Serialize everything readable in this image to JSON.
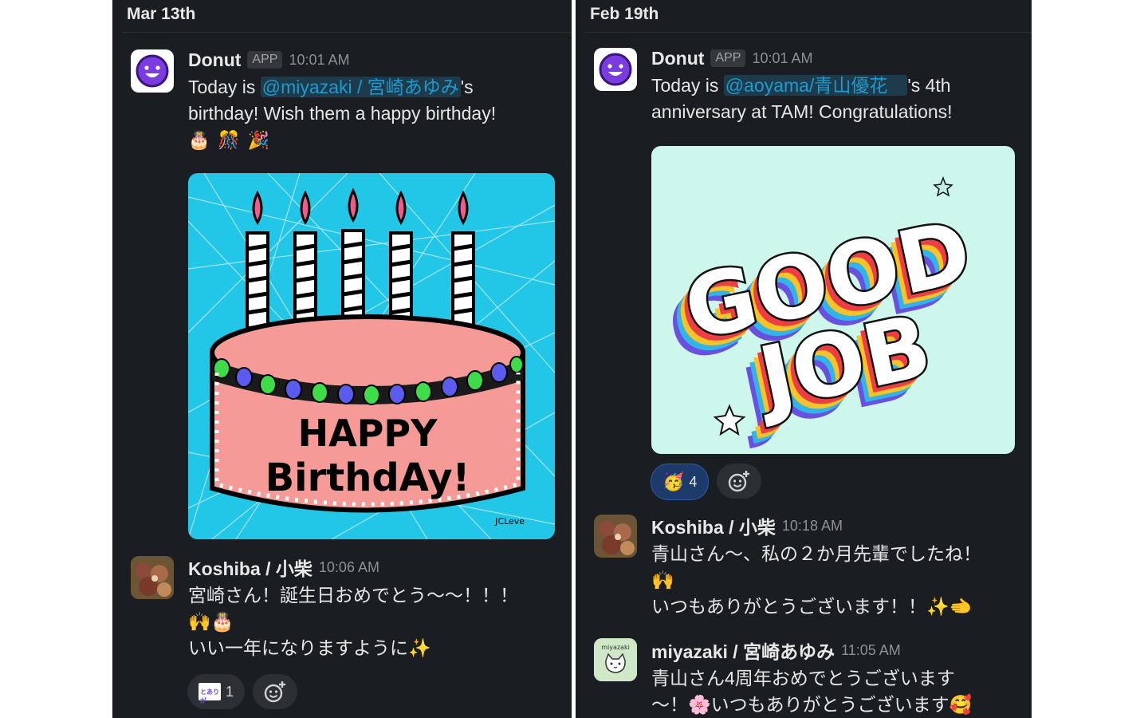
{
  "left": {
    "date": "Mar 13th",
    "donut_msg": {
      "sender": "Donut",
      "badge": "APP",
      "time": "10:01 AM",
      "text_prefix": "Today is ",
      "mention": "@miyazaki / 宮崎あゆみ",
      "text_suffix": "'s",
      "line2": "birthday! Wish them a happy birthday!",
      "emojis": [
        "🎂",
        "🎊",
        "🎉"
      ]
    },
    "card": {
      "line1": "HAPPY",
      "line2": "BirthdAy!",
      "signature": "JCLeve"
    },
    "koshiba_msg": {
      "sender": "Koshiba / 小柴",
      "time": "10:06 AM",
      "line1": "宮崎さん！誕生日おめでとう〜〜！！！",
      "line2_emoji": "🙌🎂",
      "line3": "いい一年になりますように✨"
    },
    "reaction": {
      "icon_text": "とありが",
      "count": "1"
    }
  },
  "right": {
    "date": "Feb 19th",
    "donut_msg": {
      "sender": "Donut",
      "badge": "APP",
      "time": "10:01 AM",
      "text_prefix": "Today is ",
      "mention": "@aoyama/青山優花　",
      "text_suffix": "'s 4th",
      "line2": "anniversary at TAM! Congratulations!"
    },
    "card": {
      "line1": "GOOD",
      "line2": "JOB"
    },
    "reaction": {
      "emoji": "🥳",
      "count": "4"
    },
    "koshiba_msg": {
      "sender": "Koshiba / 小柴",
      "time": "10:18 AM",
      "line1": "青山さん〜、私の２か月先輩でしたね！",
      "line2_emoji": "🙌",
      "line3": "いつもありがとうございます！！✨🫲"
    },
    "miyazaki_msg": {
      "sender": "miyazaki / 宮崎あゆみ",
      "time": "11:05 AM",
      "avatar_text": "miyazaki",
      "line1": "青山さん4周年おめでとうございます",
      "line2": "〜！🌸いつもありがとうございます🥰"
    }
  }
}
